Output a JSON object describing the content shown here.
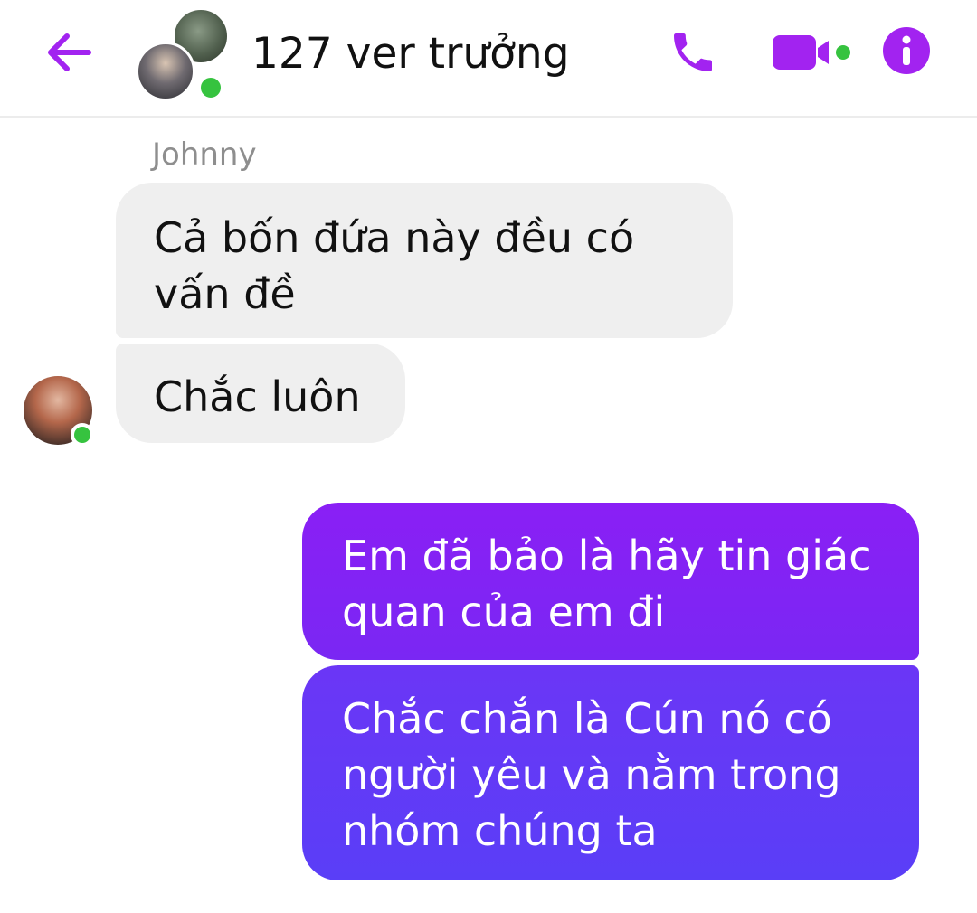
{
  "header": {
    "title": "127 ver trưởng",
    "accent_color": "#a223f0",
    "online_color": "#36c33f",
    "icons": [
      "back-arrow-icon",
      "group-avatar",
      "phone-icon",
      "video-camera-icon",
      "info-icon"
    ]
  },
  "messages": [
    {
      "sender": "Johnny",
      "direction": "incoming",
      "text": "Cả bốn đứa này đều có vấn đề"
    },
    {
      "direction": "incoming",
      "text": "Chắc luôn"
    },
    {
      "direction": "outgoing",
      "text": "Em đã bảo là hãy tin giác quan của em đi"
    },
    {
      "direction": "outgoing",
      "text": "Chắc chắn là Cún nó có người yêu và nằm trong nhóm chúng ta"
    }
  ],
  "colors": {
    "incoming_bubble": "#efefef",
    "outgoing_bubble_top": "#8a1ff5",
    "outgoing_bubble_bottom": "#5a3ef7"
  }
}
